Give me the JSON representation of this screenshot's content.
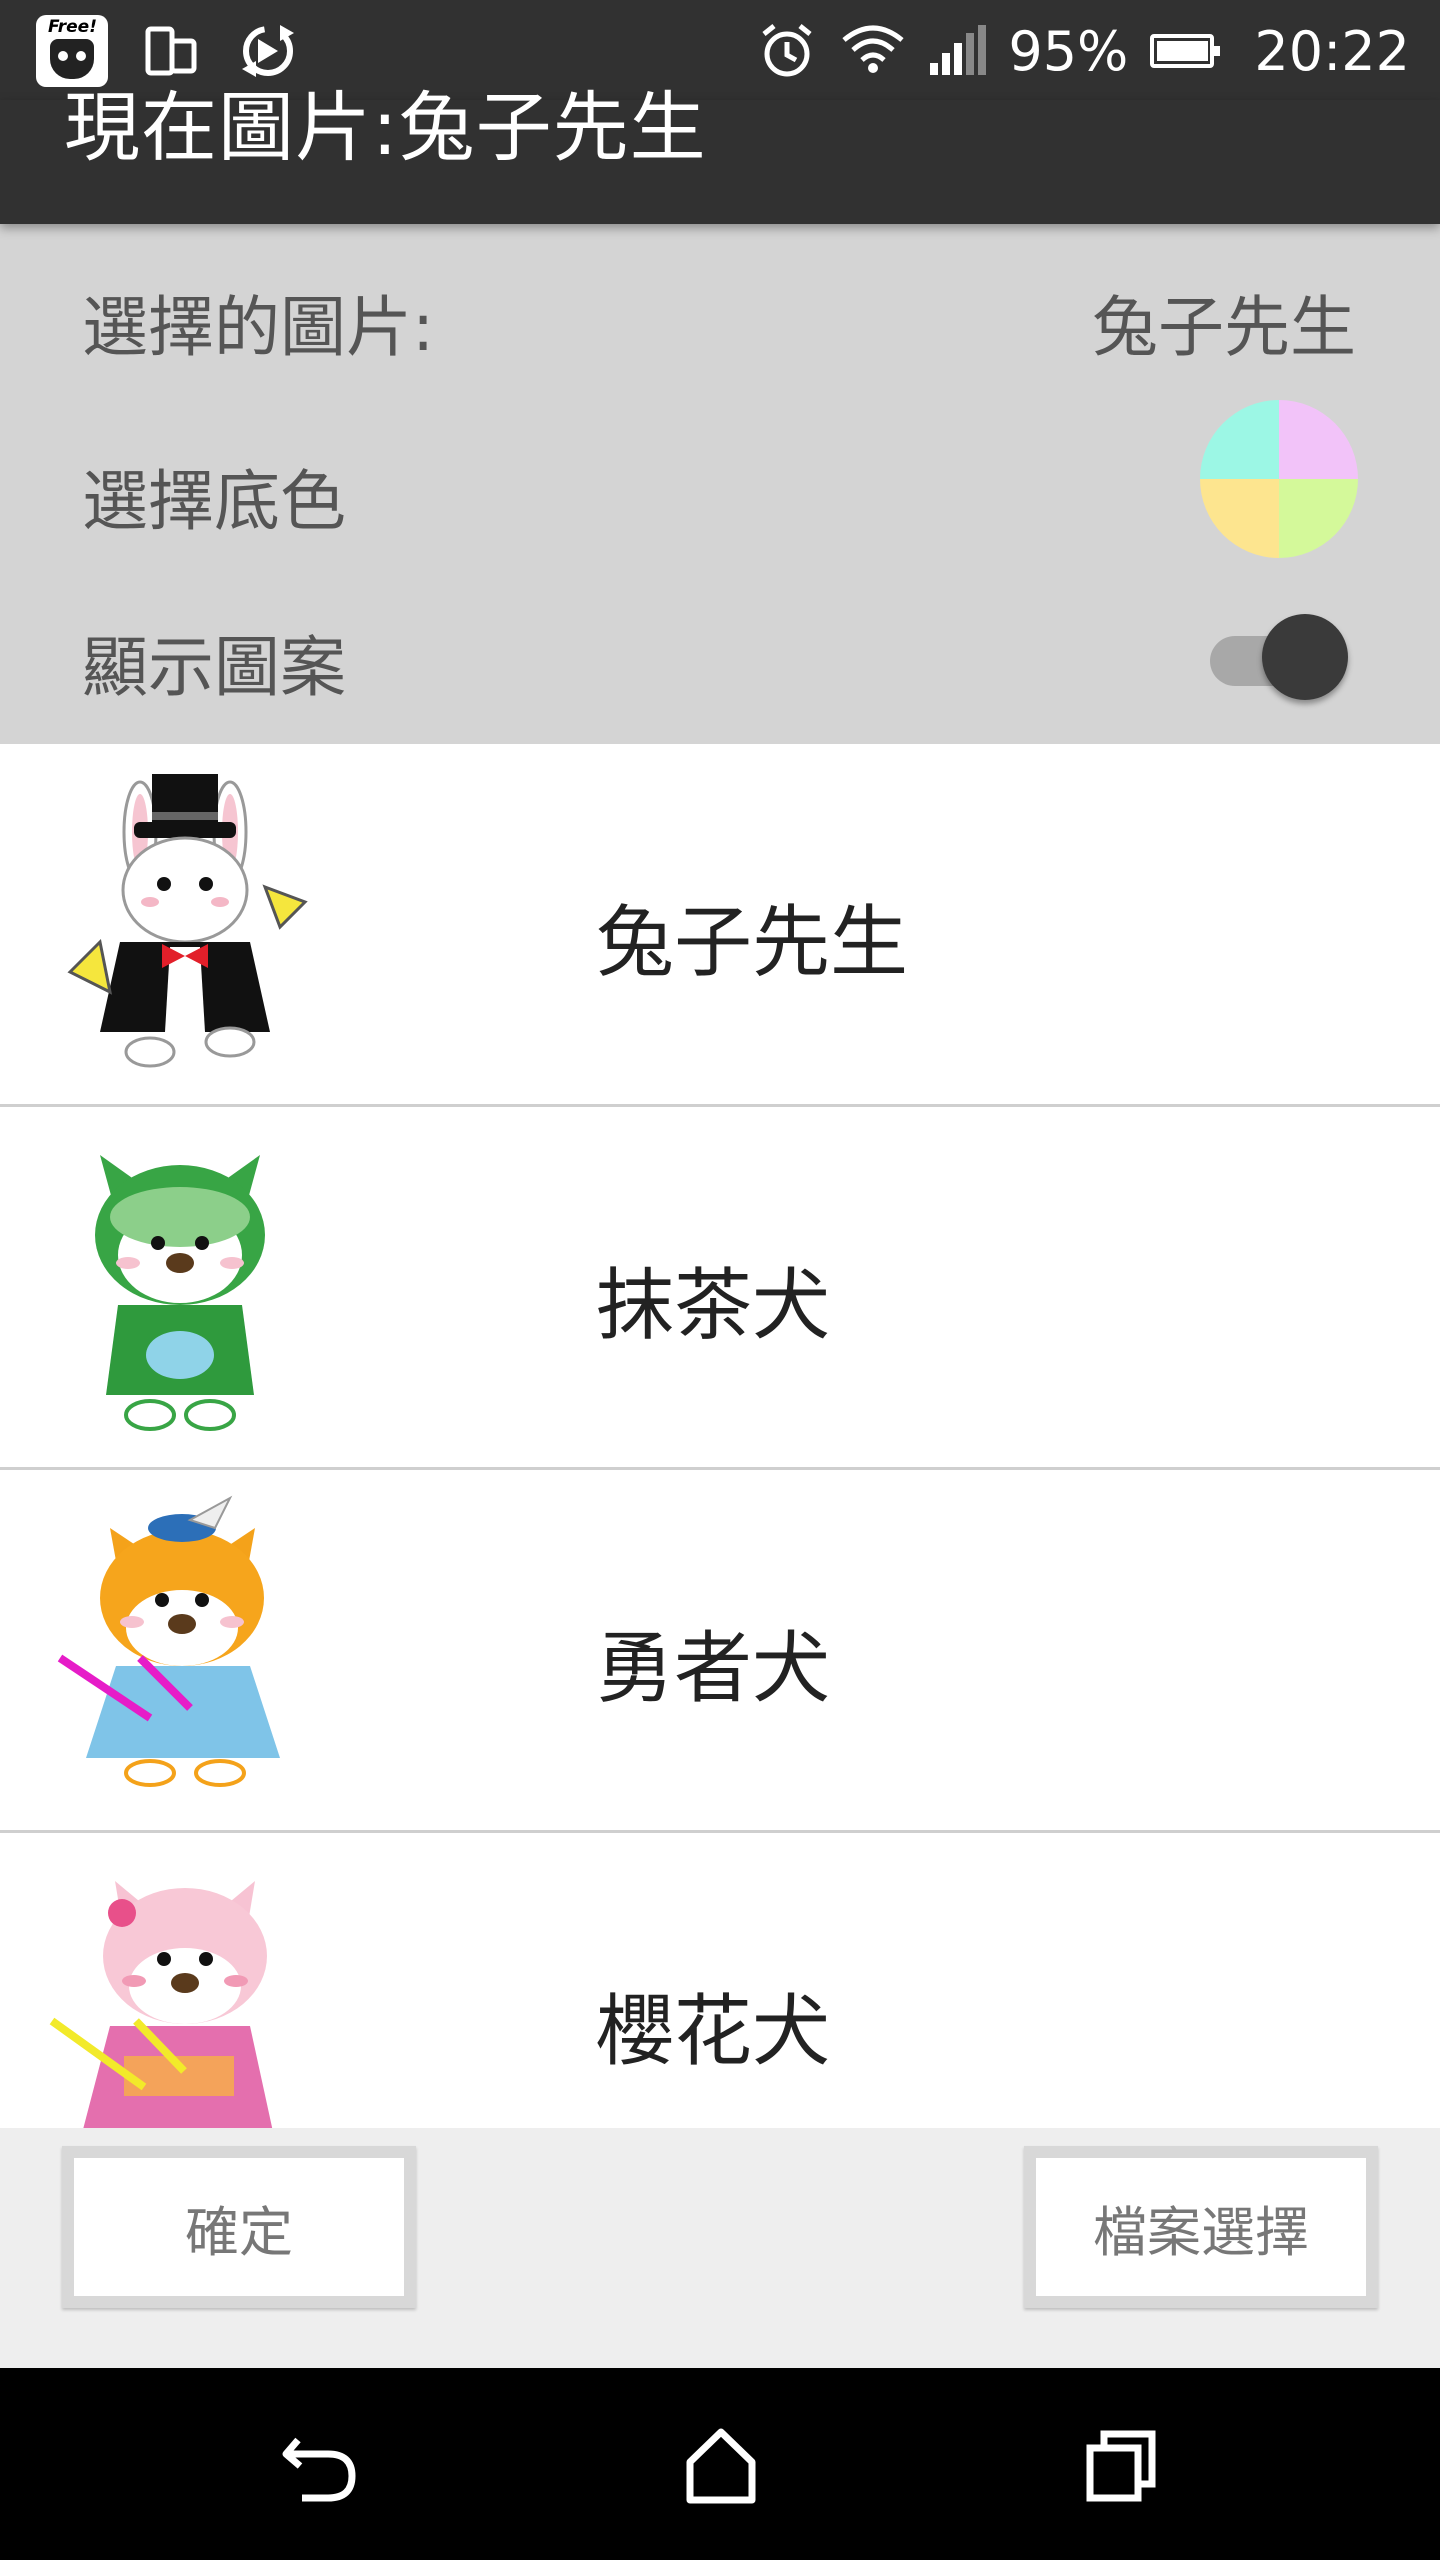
{
  "status_bar": {
    "app_badge_text": "Free!",
    "battery_percent": "95%",
    "time": "20:22",
    "icons": [
      "app-notification-icon",
      "device-icon",
      "sync-icon",
      "alarm-icon",
      "wifi-icon",
      "signal-icon",
      "battery-icon"
    ]
  },
  "toolbar": {
    "title": "現在圖片:兔子先生"
  },
  "settings": {
    "selected_picture_label": "選擇的圖片:",
    "selected_picture_value": "兔子先生",
    "background_color_label": "選擇底色",
    "background_colors": [
      "#f2c3f9",
      "#d4f99a",
      "#fde58f",
      "#9cf7e5"
    ],
    "show_pattern_label": "顯示圖案",
    "show_pattern_on": true
  },
  "list": {
    "items": [
      {
        "name": "兔子先生",
        "icon": "rabbit-gentleman-icon"
      },
      {
        "name": "抹茶犬",
        "icon": "matcha-dog-icon"
      },
      {
        "name": "勇者犬",
        "icon": "hero-dog-icon"
      },
      {
        "name": "櫻花犬",
        "icon": "sakura-dog-icon"
      }
    ]
  },
  "buttons": {
    "confirm_label": "確定",
    "file_select_label": "檔案選擇"
  },
  "nav_bar": {
    "icons": [
      "back-icon",
      "home-icon",
      "recents-icon"
    ]
  }
}
